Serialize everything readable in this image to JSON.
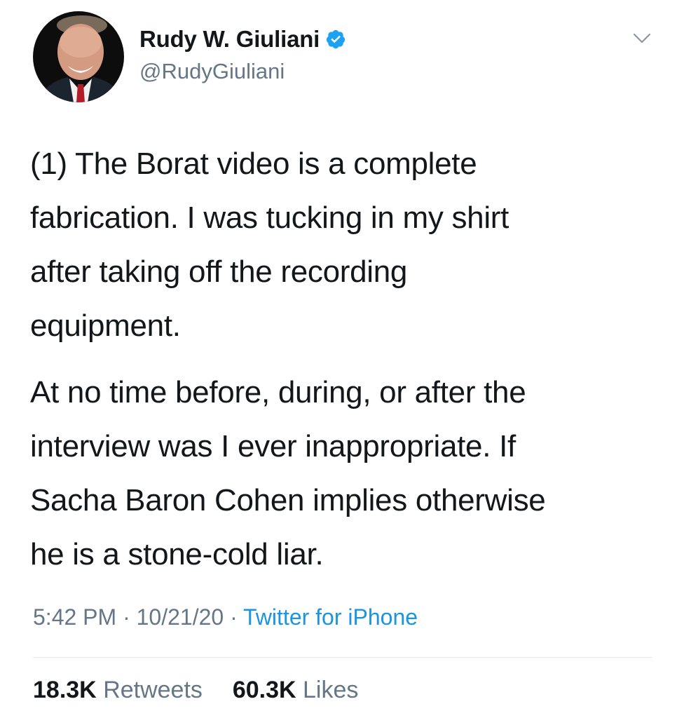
{
  "author": {
    "display_name": "Rudy W. Giuliani",
    "handle": "@RudyGiuliani",
    "verified": true,
    "avatar_icon": "profile-photo"
  },
  "tweet": {
    "paragraph_1_lines": [
      "(1) The Borat video is a complete",
      "fabrication. I was tucking in my shirt",
      "after taking off the recording",
      "equipment."
    ],
    "paragraph_2_lines": [
      "At no time before, during, or after the",
      "interview was I ever inappropriate. If",
      "Sacha Baron Cohen implies otherwise",
      "he is a stone-cold liar."
    ]
  },
  "meta": {
    "time": "5:42 PM",
    "date": "10/21/20",
    "separator": "·",
    "source": "Twitter for iPhone"
  },
  "stats": {
    "retweets_count": "18.3K",
    "retweets_label": "Retweets",
    "likes_count": "60.3K",
    "likes_label": "Likes"
  },
  "colors": {
    "text_primary": "#14171a",
    "text_secondary": "#657786",
    "link": "#1b95e0",
    "verified_badge": "#1da1f2",
    "divider": "#e1e8ed"
  }
}
